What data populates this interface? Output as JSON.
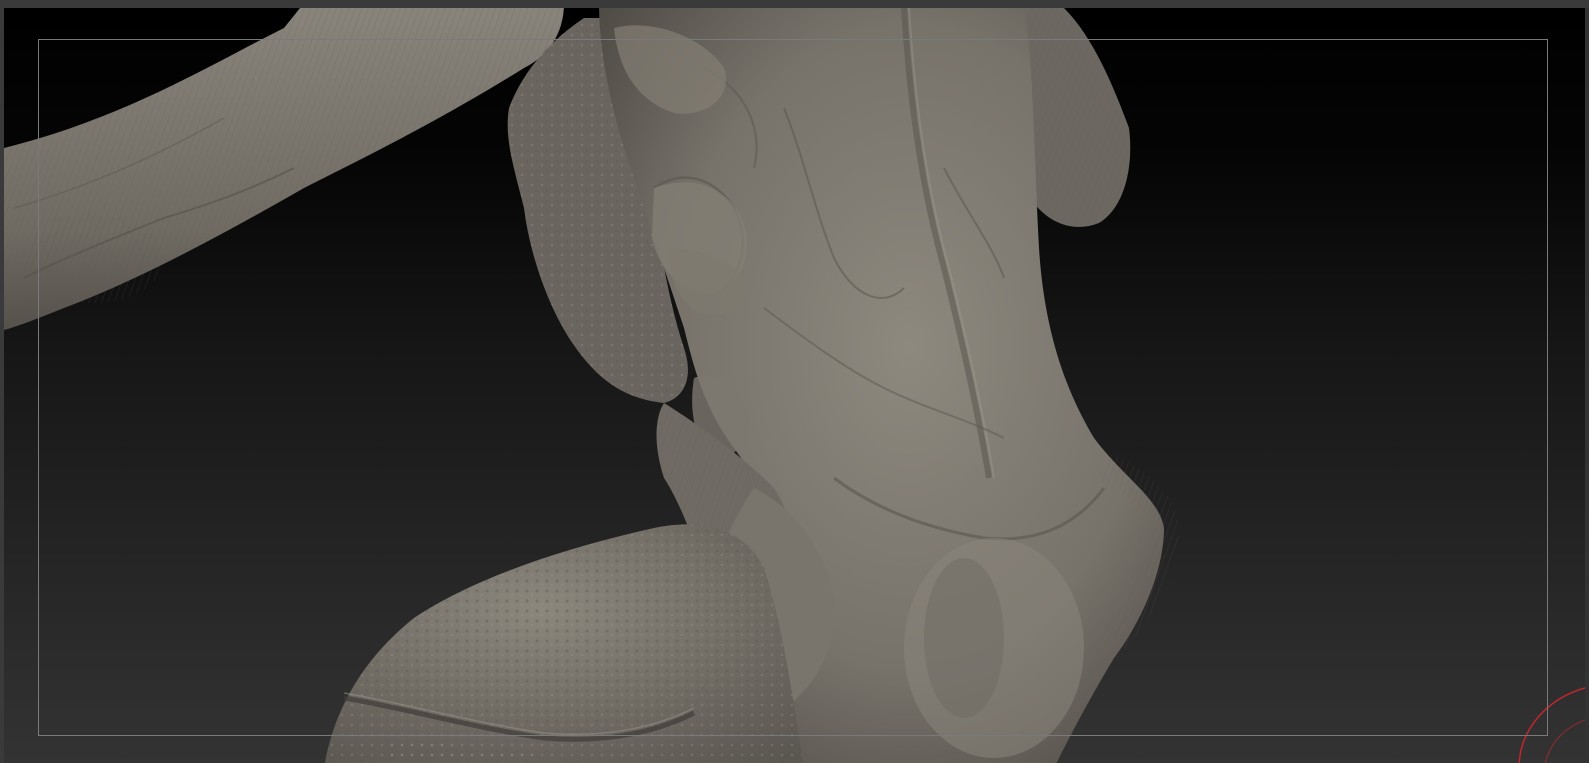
{
  "viewport": {
    "subject": "sculpt-mesh",
    "material_color": "#7b766c",
    "background_top": "#000000",
    "background_bottom": "#333333",
    "frame_color": "#7a7a7a",
    "gizmo_color": "#c0272d"
  }
}
